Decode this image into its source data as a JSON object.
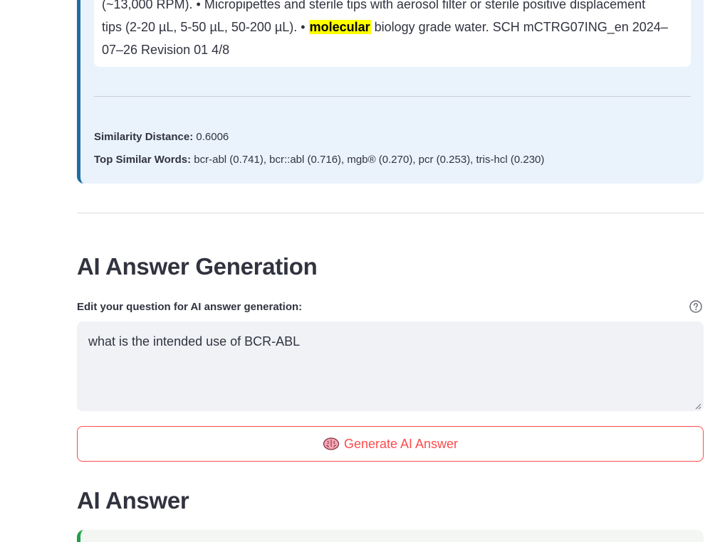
{
  "result": {
    "snippet_lines": [
      {
        "before": "(~13,000 RPM). • Micropipettes and sterile tips with aerosol filter or sterile positive displacement",
        "highlight": "",
        "after": ""
      },
      {
        "before": "tips (2-20 µL, 5-50 µL, 50-200 µL). • ",
        "highlight": "molecular",
        "after": " biology grade water. SCH mCTRG07ING_en 2024–"
      },
      {
        "before": "07–26 Revision 01 4/8",
        "highlight": "",
        "after": ""
      }
    ],
    "similarity_label": "Similarity Distance:",
    "similarity_value": " 0.6006",
    "top_words_label": "Top Similar Words:",
    "top_words_value": " bcr-abl (0.741), bcr::abl (0.716), mgb® (0.270), pcr (0.253), tris-hcl (0.230)"
  },
  "ai_generation": {
    "heading": "AI Answer Generation",
    "field_label": "Edit your question for AI answer generation:",
    "question_value": "what is the intended use of BCR-ABL",
    "button_label": "Generate AI Answer",
    "button_icon": "brain-icon"
  },
  "ai_answer": {
    "heading": "AI Answer"
  },
  "colors": {
    "accent_red": "#ff4b4b",
    "card_border_blue": "#1c6ea4",
    "card_bg_blue": "#eaf3fc",
    "answer_border_green": "#21a04a",
    "highlight_yellow": "#ffff00"
  }
}
